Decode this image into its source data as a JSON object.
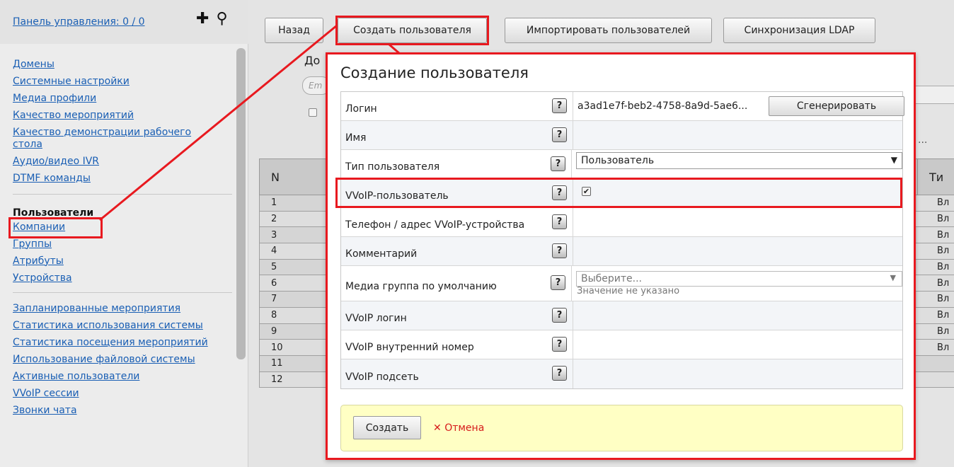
{
  "sidebar": {
    "dashboard_link": "Панель управления: 0 / 0",
    "icons": [
      "plus-icon",
      "search-icon"
    ],
    "group1": [
      "Домены",
      "Системные настройки",
      "Медиа профили",
      "Качество мероприятий",
      "Качество демонстрации рабочего стола",
      "Аудио/видео IVR",
      "DTMF команды"
    ],
    "active_item": "Пользователи",
    "group2": [
      "Компании",
      "Группы",
      "Атрибуты",
      "Устройства"
    ],
    "group3": [
      "Запланированные мероприятия",
      "Статистика использования системы",
      "Статистика посещения мероприятий",
      "Использование файловой системы",
      "Активные пользователи",
      "VVoIP сессии",
      "Звонки чата"
    ]
  },
  "toolbar": {
    "back": "Назад",
    "create_user": "Создать пользователя",
    "import_users": "Импортировать пользователей",
    "ldap_sync": "Синхронизация LDAP"
  },
  "background": {
    "domain_label_fragment": "До",
    "email_placeholder_fragment": "Em",
    "ellipsis": "...",
    "table_header_n": "N",
    "table_header_right_fragment": "Ти",
    "row_numbers": [
      "1",
      "2",
      "3",
      "4",
      "5",
      "6",
      "7",
      "8",
      "9",
      "10",
      "11",
      "12"
    ],
    "right_col_values": [
      "Вл",
      "Вл",
      "Вл",
      "Вл",
      "Вл",
      "Вл",
      "Вл",
      "Вл",
      "Вл",
      "Вл"
    ]
  },
  "modal": {
    "title": "Создание пользователя",
    "help_glyph": "?",
    "rows": [
      {
        "label": "Логин",
        "value": "a3ad1e7f-beb2-4758-8a9d-5ae6...",
        "button": "Сгенерировать"
      },
      {
        "label": "Имя",
        "value": ""
      },
      {
        "label": "Тип пользователя",
        "select": "Пользователь"
      },
      {
        "label": "VVoIP-пользователь",
        "checked": true
      },
      {
        "label": "Телефон / адрес VVoIP-устройства",
        "value": ""
      },
      {
        "label": "Комментарий",
        "value": ""
      },
      {
        "label": "Медиа группа по умолчанию",
        "placeholder": "Выберите...",
        "hint": "Значение не указано"
      },
      {
        "label": "VVoIP логин",
        "value": ""
      },
      {
        "label": "VVoIP внутренний номер",
        "value": ""
      },
      {
        "label": "VVoIP подсеть",
        "value": ""
      }
    ],
    "create_button": "Создать",
    "cancel_link": "Отмена",
    "cancel_icon": "close-icon"
  },
  "colors": {
    "annotation_red": "#e8191f",
    "link_blue": "#1a5fb4",
    "footer_yellow": "#ffffc4",
    "cancel_red": "#d61a1a"
  }
}
